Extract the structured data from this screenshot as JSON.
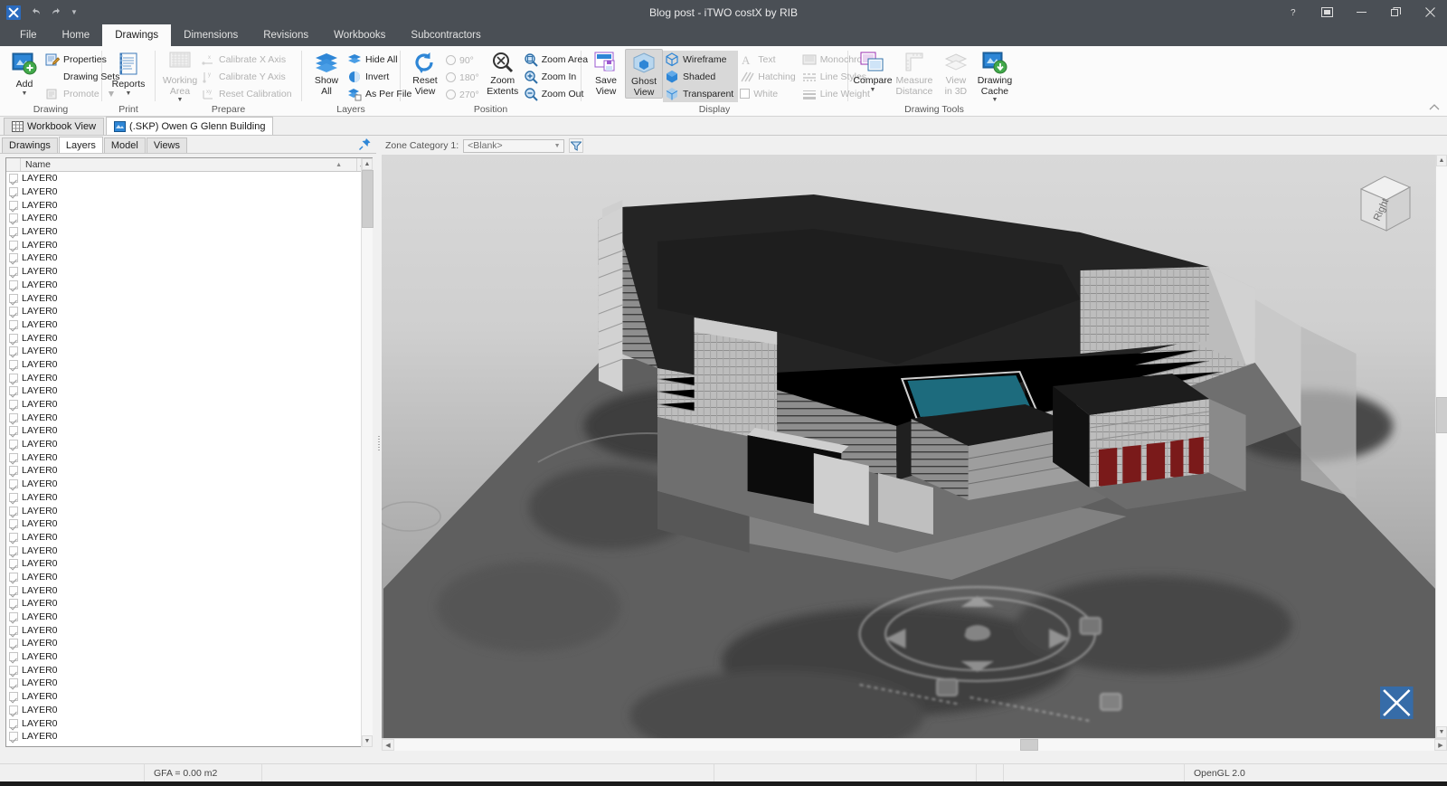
{
  "window": {
    "title": "Blog post - iTWO costX by RIB",
    "quick_access": [
      "undo-icon",
      "redo-icon",
      "customize-caret-icon"
    ],
    "controls": [
      {
        "name": "help-button",
        "glyph": "?"
      },
      {
        "name": "ribbon-display-options-button",
        "glyph": "❐"
      },
      {
        "name": "minimize-button",
        "glyph": "—"
      },
      {
        "name": "restore-button",
        "glyph": "❐"
      },
      {
        "name": "close-button",
        "glyph": "✕"
      }
    ]
  },
  "ribbon": {
    "tabs": [
      {
        "label": "File",
        "active": false
      },
      {
        "label": "Home",
        "active": false
      },
      {
        "label": "Drawings",
        "active": true
      },
      {
        "label": "Dimensions",
        "active": false
      },
      {
        "label": "Revisions",
        "active": false
      },
      {
        "label": "Workbooks",
        "active": false
      },
      {
        "label": "Subcontractors",
        "active": false
      }
    ],
    "groups": [
      {
        "title": "Drawing",
        "big": [
          {
            "label": "Add",
            "icon": "add-drawing-icon",
            "caret": true,
            "disabled": false
          }
        ],
        "small": [
          {
            "label": "Properties",
            "icon": "properties-icon",
            "disabled": false
          },
          {
            "label": "Drawing Sets",
            "icon": "drawing-sets-icon",
            "disabled": false
          },
          {
            "label": "Promote",
            "icon": "promote-icon",
            "disabled": true,
            "caret": true
          }
        ]
      },
      {
        "title": "Print",
        "big": [
          {
            "label": "Reports",
            "icon": "reports-icon",
            "caret": true,
            "disabled": false
          }
        ],
        "small": []
      },
      {
        "title": "Prepare",
        "big": [
          {
            "label": "Working Area",
            "icon": "working-area-icon",
            "caret": true,
            "disabled": true
          }
        ],
        "small": [
          {
            "label": "Calibrate X Axis",
            "icon": "calibrate-x-icon",
            "disabled": true
          },
          {
            "label": "Calibrate Y Axis",
            "icon": "calibrate-y-icon",
            "disabled": true
          },
          {
            "label": "Reset Calibration",
            "icon": "reset-calibration-icon",
            "disabled": true
          }
        ]
      },
      {
        "title": "Layers",
        "big": [
          {
            "label": "Show All",
            "icon": "show-all-layers-icon",
            "disabled": false
          }
        ],
        "small": [
          {
            "label": "Hide All",
            "icon": "hide-all-layers-icon",
            "disabled": false
          },
          {
            "label": "Invert",
            "icon": "invert-layers-icon",
            "disabled": false
          },
          {
            "label": "As Per File",
            "icon": "as-per-file-icon",
            "disabled": false
          }
        ]
      },
      {
        "title": "Position",
        "big": [
          {
            "label": "Reset View",
            "icon": "reset-view-icon",
            "disabled": false
          }
        ],
        "radios": [
          {
            "label": "90°",
            "disabled": true
          },
          {
            "label": "180°",
            "disabled": true
          },
          {
            "label": "270°",
            "disabled": true
          }
        ],
        "big2": [
          {
            "label": "Zoom Extents",
            "icon": "zoom-extents-icon",
            "disabled": false
          }
        ],
        "small": [
          {
            "label": "Zoom Area",
            "icon": "zoom-area-icon",
            "disabled": false
          },
          {
            "label": "Zoom In",
            "icon": "zoom-in-icon",
            "disabled": false
          },
          {
            "label": "Zoom Out",
            "icon": "zoom-out-icon",
            "disabled": false
          }
        ]
      },
      {
        "title": "Display",
        "big": [
          {
            "label": "Save View",
            "icon": "save-view-icon",
            "disabled": false
          },
          {
            "label": "Ghost View",
            "icon": "ghost-view-icon",
            "disabled": false,
            "active": true
          }
        ],
        "small_a": [
          {
            "label": "Wireframe",
            "icon": "wireframe-icon",
            "disabled": false,
            "selected": true
          },
          {
            "label": "Shaded",
            "icon": "shaded-icon",
            "disabled": false,
            "selected": true
          },
          {
            "label": "Transparent",
            "icon": "transparent-icon",
            "disabled": false,
            "selected": true
          }
        ],
        "small_b": [
          {
            "label": "Text",
            "icon": "text-icon",
            "disabled": true
          },
          {
            "label": "Hatching",
            "icon": "hatching-icon",
            "disabled": true
          },
          {
            "label": "White",
            "icon": "white-checkbox-icon",
            "disabled": true,
            "checkbox": true
          }
        ],
        "small_c": [
          {
            "label": "Monochrome",
            "icon": "monochrome-icon",
            "disabled": true
          },
          {
            "label": "Line Styles",
            "icon": "line-styles-icon",
            "disabled": true
          },
          {
            "label": "Line Weight",
            "icon": "line-weight-icon",
            "disabled": true
          }
        ]
      },
      {
        "title": "Drawing Tools",
        "big": [
          {
            "label": "Compare",
            "icon": "compare-icon",
            "caret": true,
            "disabled": false
          },
          {
            "label": "Measure Distance",
            "icon": "measure-distance-icon",
            "disabled": true
          },
          {
            "label": "View in 3D",
            "icon": "view-in-3d-icon",
            "disabled": true
          },
          {
            "label": "Drawing Cache",
            "icon": "drawing-cache-icon",
            "caret": true,
            "disabled": false
          }
        ]
      }
    ]
  },
  "document_tabs": [
    {
      "label": "Workbook View",
      "icon": "workbook-grid-icon",
      "active": false
    },
    {
      "label": "(.SKP) Owen G Glenn Building",
      "icon": "drawing-file-icon",
      "active": true
    }
  ],
  "left_panel": {
    "tabs": [
      {
        "label": "Drawings",
        "active": false
      },
      {
        "label": "Layers",
        "active": true
      },
      {
        "label": "Model",
        "active": false
      },
      {
        "label": "Views",
        "active": false
      }
    ],
    "pin_icon": "pin-icon",
    "grid": {
      "columns": [
        "",
        "Name"
      ],
      "sort_column": "Name",
      "sort_direction": "ascending",
      "row_label": "LAYER0",
      "row_count": 43,
      "all_checked": true
    }
  },
  "viewport": {
    "zone_category_label": "Zone Category 1:",
    "zone_category_value": "<Blank>",
    "filter_icon": "filter-icon",
    "view_cube_label": "Right",
    "nav_gizmo": "navigation-gizmo",
    "model_colors": {
      "roof_dark": "#2b2b2b",
      "facade_light": "#bdbdbd",
      "ground": "#6e6e6e",
      "pool_teal": "#1d6b7d",
      "panel_red": "#7a1a1a",
      "sky_top": "#d6d6d6",
      "sky_bottom": "#8a8a8a"
    }
  },
  "status_bar": {
    "gfa": "GFA = 0.00 m2",
    "renderer": "OpenGL 2.0"
  }
}
